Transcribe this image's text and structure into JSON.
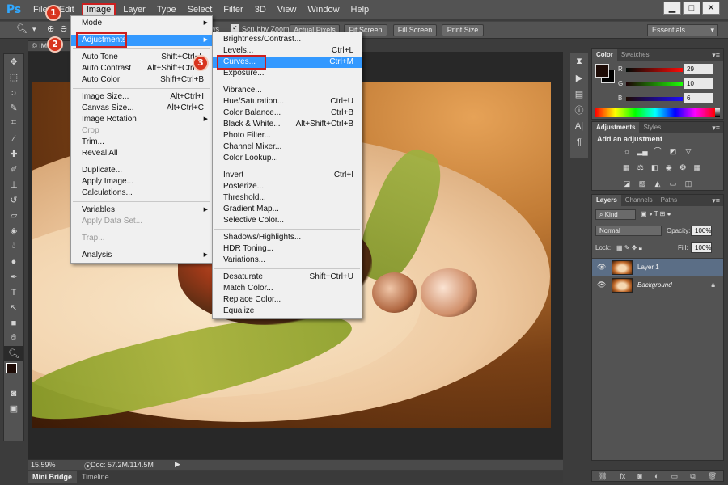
{
  "app": {
    "logo": "Ps"
  },
  "menubar": {
    "items": [
      "File",
      "Edit",
      "Image",
      "Layer",
      "Type",
      "Select",
      "Filter",
      "3D",
      "View",
      "Window",
      "Help"
    ],
    "active_label": "Image"
  },
  "window_controls": {
    "minimize": "▁",
    "maximize": "□",
    "close": "✕"
  },
  "options": {
    "windows_label": "ws",
    "scrubby_zoom": "Scrubby Zoom",
    "actual_pixels": "Actual Pixels",
    "fit_screen": "Fit Screen",
    "fill_screen": "Fill Screen",
    "print_size": "Print Size",
    "workspace": "Essentials"
  },
  "document": {
    "tab_label": "© IM",
    "zoom": "15.59%",
    "doc_info": "Doc: 57.2M/114.5M"
  },
  "bottom_tabs": [
    "Mini Bridge",
    "Timeline"
  ],
  "image_menu": {
    "items": [
      {
        "label": "Mode",
        "shortcut": "",
        "submenu": true
      },
      {
        "sep": true
      },
      {
        "label": "Adjustments",
        "shortcut": "",
        "submenu": true,
        "highlight": true
      },
      {
        "sep": true
      },
      {
        "label": "Auto Tone",
        "shortcut": "Shift+Ctrl+L"
      },
      {
        "label": "Auto Contrast",
        "shortcut": "Alt+Shift+Ctrl+L"
      },
      {
        "label": "Auto Color",
        "shortcut": "Shift+Ctrl+B"
      },
      {
        "sep": true
      },
      {
        "label": "Image Size...",
        "shortcut": "Alt+Ctrl+I"
      },
      {
        "label": "Canvas Size...",
        "shortcut": "Alt+Ctrl+C"
      },
      {
        "label": "Image Rotation",
        "shortcut": "",
        "submenu": true
      },
      {
        "label": "Crop",
        "shortcut": "",
        "disabled": true
      },
      {
        "label": "Trim...",
        "shortcut": ""
      },
      {
        "label": "Reveal All",
        "shortcut": ""
      },
      {
        "sep": true
      },
      {
        "label": "Duplicate...",
        "shortcut": ""
      },
      {
        "label": "Apply Image...",
        "shortcut": ""
      },
      {
        "label": "Calculations...",
        "shortcut": ""
      },
      {
        "sep": true
      },
      {
        "label": "Variables",
        "shortcut": "",
        "submenu": true
      },
      {
        "label": "Apply Data Set...",
        "shortcut": "",
        "disabled": true
      },
      {
        "sep": true
      },
      {
        "label": "Trap...",
        "shortcut": "",
        "disabled": true
      },
      {
        "sep": true
      },
      {
        "label": "Analysis",
        "shortcut": "",
        "submenu": true
      }
    ]
  },
  "adjustments_menu": {
    "items": [
      {
        "label": "Brightness/Contrast...",
        "shortcut": ""
      },
      {
        "label": "Levels...",
        "shortcut": "Ctrl+L"
      },
      {
        "label": "Curves...",
        "shortcut": "Ctrl+M",
        "highlight": true
      },
      {
        "label": "Exposure...",
        "shortcut": ""
      },
      {
        "sep": true
      },
      {
        "label": "Vibrance...",
        "shortcut": ""
      },
      {
        "label": "Hue/Saturation...",
        "shortcut": "Ctrl+U"
      },
      {
        "label": "Color Balance...",
        "shortcut": "Ctrl+B"
      },
      {
        "label": "Black & White...",
        "shortcut": "Alt+Shift+Ctrl+B"
      },
      {
        "label": "Photo Filter...",
        "shortcut": ""
      },
      {
        "label": "Channel Mixer...",
        "shortcut": ""
      },
      {
        "label": "Color Lookup...",
        "shortcut": ""
      },
      {
        "sep": true
      },
      {
        "label": "Invert",
        "shortcut": "Ctrl+I"
      },
      {
        "label": "Posterize...",
        "shortcut": ""
      },
      {
        "label": "Threshold...",
        "shortcut": ""
      },
      {
        "label": "Gradient Map...",
        "shortcut": ""
      },
      {
        "label": "Selective Color...",
        "shortcut": ""
      },
      {
        "sep": true
      },
      {
        "label": "Shadows/Highlights...",
        "shortcut": ""
      },
      {
        "label": "HDR Toning...",
        "shortcut": ""
      },
      {
        "label": "Variations...",
        "shortcut": ""
      },
      {
        "sep": true
      },
      {
        "label": "Desaturate",
        "shortcut": "Shift+Ctrl+U"
      },
      {
        "label": "Match Color...",
        "shortcut": ""
      },
      {
        "label": "Replace Color...",
        "shortcut": ""
      },
      {
        "label": "Equalize",
        "shortcut": ""
      }
    ]
  },
  "badges": [
    "1",
    "2",
    "3"
  ],
  "color_panel": {
    "tabs": [
      "Color",
      "Swatches"
    ],
    "r_label": "R",
    "g_label": "G",
    "b_label": "B",
    "r": "29",
    "g": "10",
    "b": "6",
    "foreground_color": "#1d0b06"
  },
  "adjustments_panel": {
    "tabs": [
      "Adjustments",
      "Styles"
    ],
    "title": "Add an adjustment"
  },
  "layers_panel": {
    "tabs": [
      "Layers",
      "Channels",
      "Paths"
    ],
    "kind": "Kind",
    "blend_mode": "Normal",
    "opacity_label": "Opacity:",
    "opacity": "100%",
    "lock_label": "Lock:",
    "fill_label": "Fill:",
    "fill": "100%",
    "layers": [
      {
        "name": "Layer 1",
        "selected": true
      },
      {
        "name": "Background",
        "selected": false,
        "locked": true
      }
    ]
  },
  "colors": {
    "highlight": "#3399ff",
    "annotation_red": "#cc1f1f"
  }
}
